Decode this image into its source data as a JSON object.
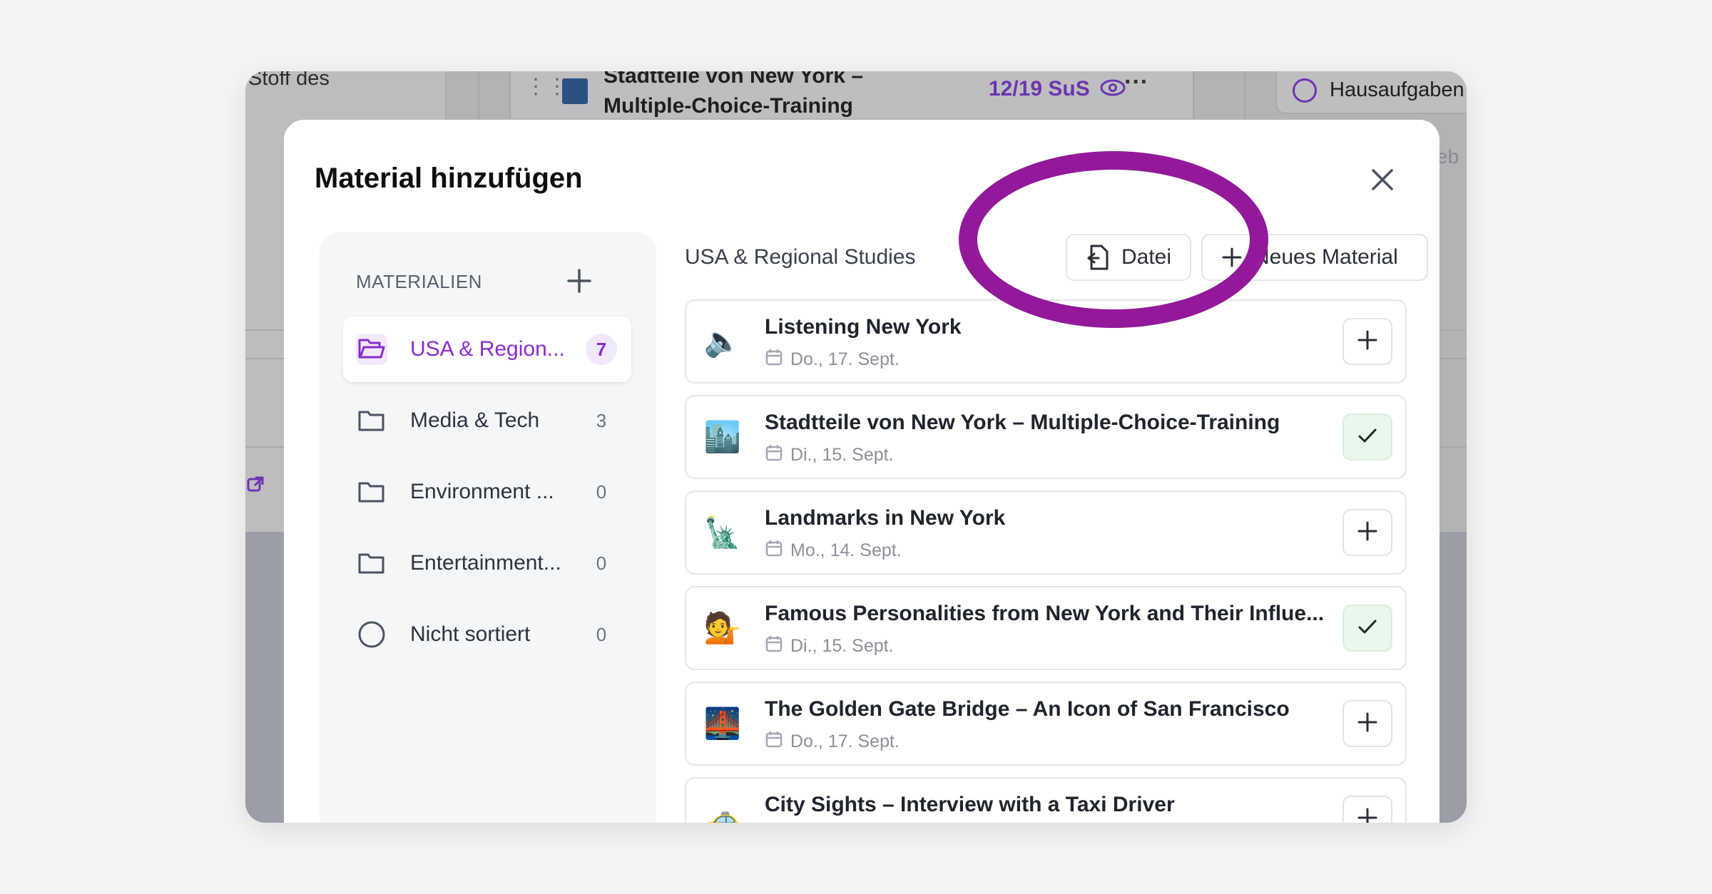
{
  "background": {
    "left_text": "Stoff des",
    "card_title_line1": "Stadtteile von New York –",
    "card_title_line2": "Multiple-Choice-Training",
    "card_badge": "12/19 SuS",
    "card_menu": "···",
    "right_card_text": "Hausaufgaben",
    "right_partial": "eb"
  },
  "modal": {
    "title": "Material hinzufügen"
  },
  "sidebar": {
    "header": "MATERIALIEN",
    "folders": [
      {
        "label": "USA & Region...",
        "count": "7",
        "active": true,
        "icon": "folder-open-icon"
      },
      {
        "label": "Media & Tech",
        "count": "3",
        "icon": "folder-icon"
      },
      {
        "label": "Environment ...",
        "count": "0",
        "icon": "folder-icon"
      },
      {
        "label": "Entertainment...",
        "count": "0",
        "icon": "folder-icon"
      },
      {
        "label": "Nicht sortiert",
        "count": "0",
        "icon": "circle-icon"
      }
    ]
  },
  "main": {
    "section_title": "USA & Regional Studies",
    "file_button": "Datei",
    "new_material_button": "Neues Material",
    "items": [
      {
        "emoji": "🔈",
        "title": "Listening New York",
        "date": "Do., 17. Sept.",
        "added": false
      },
      {
        "emoji": "🏙️",
        "title": "Stadtteile von New York – Multiple-Choice-Training",
        "date": "Di., 15. Sept.",
        "added": true
      },
      {
        "emoji": "🗽",
        "title": "Landmarks in New York",
        "date": "Mo., 14. Sept.",
        "added": false
      },
      {
        "emoji": "💁",
        "title": "Famous Personalities from New York and Their Influe...",
        "date": "Di., 15. Sept.",
        "added": true
      },
      {
        "emoji": "🌉",
        "title": "The Golden Gate Bridge – An Icon of San Francisco",
        "date": "Do., 17. Sept.",
        "added": false
      },
      {
        "emoji": "🚕",
        "title": "City Sights – Interview with a Taxi Driver",
        "date": "",
        "added": false
      }
    ]
  },
  "colors": {
    "accent": "#8a2bd0",
    "highlight_ring": "#93199a",
    "added_bg": "#eaf7ec"
  }
}
